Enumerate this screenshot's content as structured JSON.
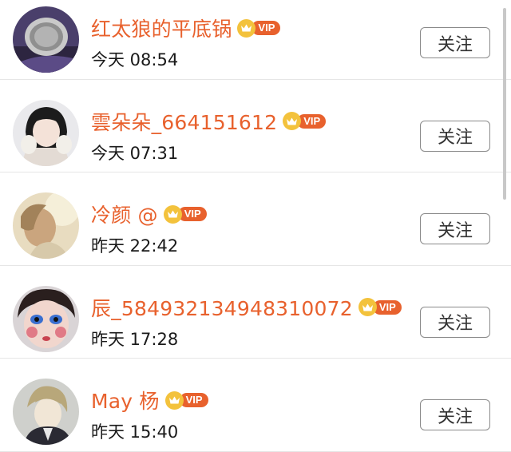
{
  "follow_list": {
    "items": [
      {
        "name": "红太狼的平底锅",
        "badge": "VIP",
        "time": "今天 08:54",
        "button": "关注",
        "avatar_icon": "frying-pan-photo"
      },
      {
        "name": "雲朵朵_664151612",
        "badge": "VIP",
        "time": "今天 07:31",
        "button": "关注",
        "avatar_icon": "girl-portrait"
      },
      {
        "name": "冷颜 @",
        "badge": "VIP",
        "time": "昨天 22:42",
        "button": "关注",
        "avatar_icon": "blurred-portrait"
      },
      {
        "name": "辰_584932134948310072",
        "badge": "VIP",
        "time": "昨天 17:28",
        "button": "关注",
        "avatar_icon": "child-face-portrait"
      },
      {
        "name": "May 杨",
        "badge": "VIP",
        "time": "昨天 15:40",
        "button": "关注",
        "avatar_icon": "anime-character-portrait"
      }
    ]
  },
  "colors": {
    "name": "#e8612d",
    "vip_tag": "#e8612d",
    "crown": "#f3c23c",
    "button_border": "#8a8a8a"
  }
}
